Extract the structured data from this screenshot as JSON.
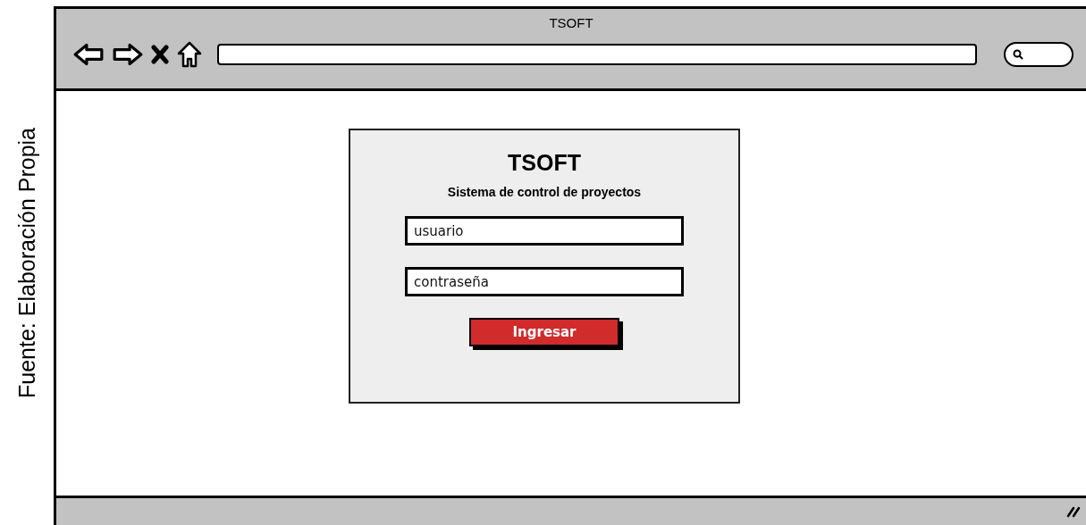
{
  "caption": "Fuente: Elaboración Propia",
  "window": {
    "title": "TSOFT"
  },
  "login": {
    "title": "TSOFT",
    "subtitle": "Sistema de control de proyectos",
    "fields": [
      {
        "placeholder": "usuario"
      },
      {
        "placeholder": "contraseña"
      }
    ],
    "button": "Ingresar"
  }
}
